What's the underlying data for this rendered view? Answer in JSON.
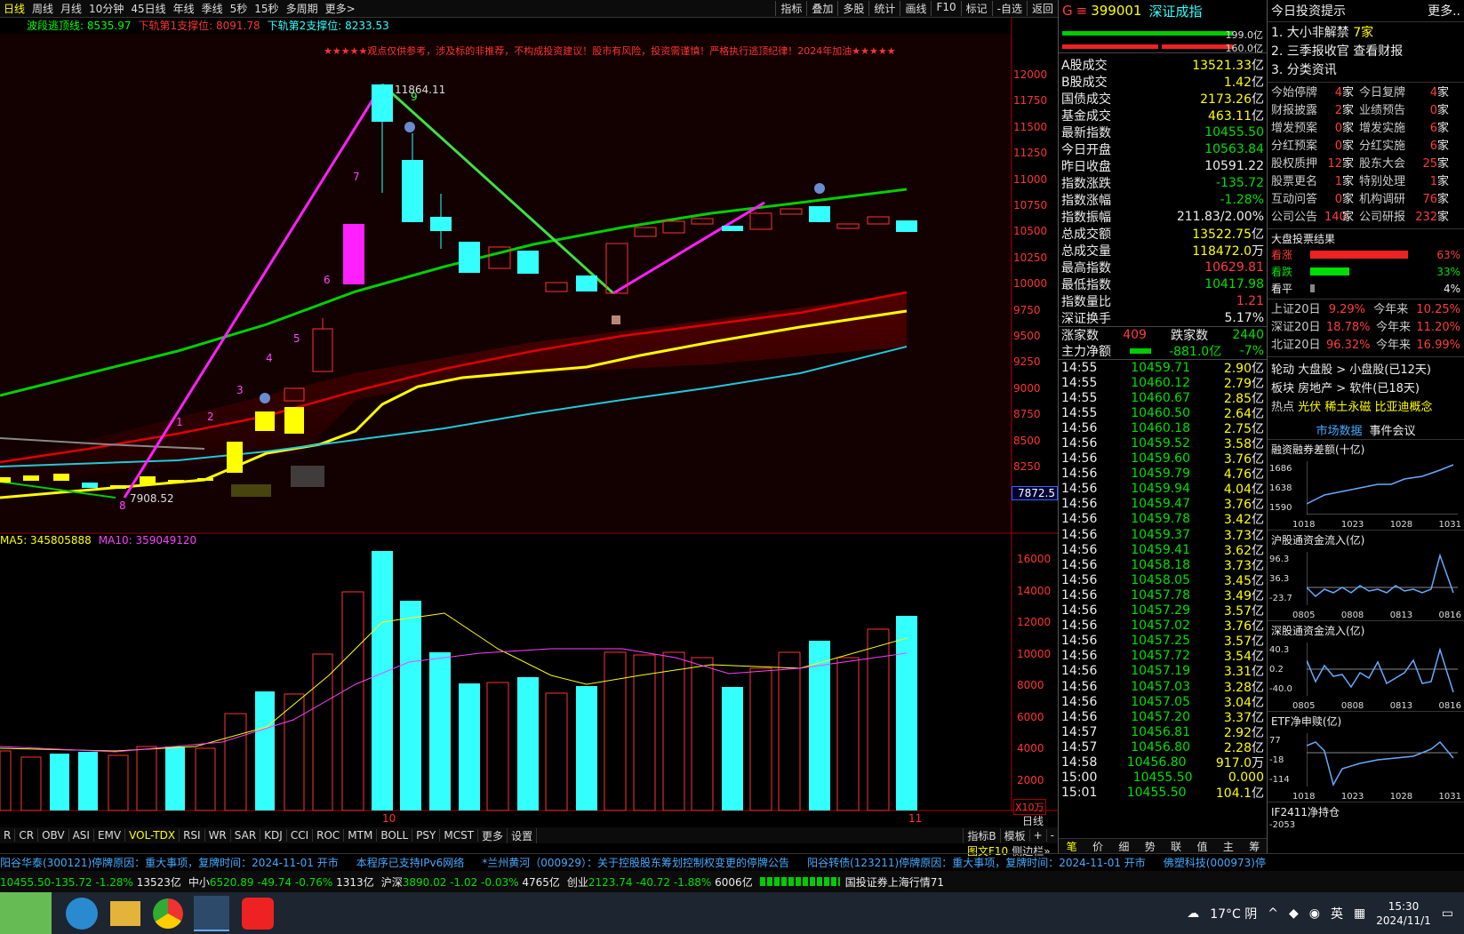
{
  "period_tabs": [
    "日线",
    "周线",
    "月线",
    "10分钟",
    "45日线",
    "年线",
    "季线",
    "5秒",
    "15秒",
    "多周期",
    "更多>"
  ],
  "tool_tabs": [
    "指标",
    "叠加",
    "多股",
    "统计",
    "画线",
    "F10",
    "标记",
    "-自选",
    "返回"
  ],
  "chart_header": {
    "indicator1": "波段逃顶线: 8535.97",
    "indicator2": "下轨第1支撑位: 8091.78",
    "indicator3": "下轨第2支撑位: 8233.53",
    "banner": "★★★★★观点仅供参考，涉及标的非推荐，不构成投资建议！股市有风险，投资需谨慎！严格执行逃顶纪律！2024年加油★★★★★"
  },
  "price_axis": [
    "12000",
    "11750",
    "11500",
    "11250",
    "11000",
    "10750",
    "10500",
    "10250",
    "10000",
    "9750",
    "9500",
    "9250",
    "9000",
    "8750",
    "8500",
    "8250"
  ],
  "price_high_label": "11864.11",
  "price_low_label": "7908.52",
  "cursor_price": "7872.5",
  "volume_header": {
    "ma5": "MA5: 345805888",
    "ma10": "MA10: 359049120"
  },
  "volume_axis": [
    "16000",
    "14000",
    "12000",
    "10000",
    "8000",
    "6000",
    "4000",
    "2000"
  ],
  "volume_unit": "X10万",
  "x_labels": [
    "10",
    "11"
  ],
  "period_label": "日线",
  "indicator_tabs": [
    "R",
    "CR",
    "OBV",
    "ASI",
    "EMV",
    "VOL-TDX",
    "RSI",
    "WR",
    "SAR",
    "KDJ",
    "CCI",
    "ROC",
    "MTM",
    "BOLL",
    "PSY",
    "MCST",
    "更多",
    "设置"
  ],
  "indicator_right": [
    "指标B",
    "模板",
    "+",
    "-"
  ],
  "candle_numbers": [
    "1",
    "2",
    "3",
    "4",
    "5",
    "6",
    "7",
    "8",
    "9"
  ],
  "quote": {
    "code": "399001",
    "name": "深证成指",
    "bar1": "199.0亿",
    "bar2": "160.0亿",
    "rows": [
      {
        "label": "A股成交",
        "value": "13521.33",
        "unit": "亿",
        "cls": "y"
      },
      {
        "label": "B股成交",
        "value": "1.42",
        "unit": "亿",
        "cls": "y"
      },
      {
        "label": "国债成交",
        "value": "2173.26",
        "unit": "亿",
        "cls": "y"
      },
      {
        "label": "基金成交",
        "value": "463.11",
        "unit": "亿",
        "cls": "y"
      },
      {
        "label": "最新指数",
        "value": "10455.50",
        "unit": "",
        "cls": "g"
      },
      {
        "label": "今日开盘",
        "value": "10563.84",
        "unit": "",
        "cls": "g"
      },
      {
        "label": "昨日收盘",
        "value": "10591.22",
        "unit": "",
        "cls": "w"
      },
      {
        "label": "指数涨跌",
        "value": "-135.72",
        "unit": "",
        "cls": "g"
      },
      {
        "label": "指数涨幅",
        "value": "-1.28%",
        "unit": "",
        "cls": "g"
      },
      {
        "label": "指数振幅",
        "value": "211.83/2.00%",
        "unit": "",
        "cls": "w"
      },
      {
        "label": "总成交额",
        "value": "13522.75",
        "unit": "亿",
        "cls": "y"
      },
      {
        "label": "总成交量",
        "value": "118472.0",
        "unit": "万",
        "cls": "y"
      },
      {
        "label": "最高指数",
        "value": "10629.81",
        "unit": "",
        "cls": "r"
      },
      {
        "label": "最低指数",
        "value": "10417.98",
        "unit": "",
        "cls": "g"
      },
      {
        "label": "指数量比",
        "value": "1.21",
        "unit": "",
        "cls": "r"
      },
      {
        "label": "深证换手",
        "value": "5.17%",
        "unit": "",
        "cls": "w"
      }
    ],
    "updown": {
      "up_label": "涨家数",
      "up": "409",
      "down_label": "跌家数",
      "down": "2440"
    },
    "mainflow": {
      "label": "主力净额",
      "value": "-881.0亿",
      "pct": "-7%"
    }
  },
  "ticks": [
    {
      "t": "14:55",
      "p": "10459.71",
      "v": "2.90",
      "u": "亿"
    },
    {
      "t": "14:55",
      "p": "10460.12",
      "v": "2.79",
      "u": "亿"
    },
    {
      "t": "14:55",
      "p": "10460.67",
      "v": "2.85",
      "u": "亿"
    },
    {
      "t": "14:55",
      "p": "10460.50",
      "v": "2.64",
      "u": "亿"
    },
    {
      "t": "14:56",
      "p": "10460.18",
      "v": "2.75",
      "u": "亿"
    },
    {
      "t": "14:56",
      "p": "10459.52",
      "v": "3.58",
      "u": "亿"
    },
    {
      "t": "14:56",
      "p": "10459.60",
      "v": "3.76",
      "u": "亿"
    },
    {
      "t": "14:56",
      "p": "10459.79",
      "v": "4.76",
      "u": "亿"
    },
    {
      "t": "14:56",
      "p": "10459.94",
      "v": "4.04",
      "u": "亿"
    },
    {
      "t": "14:56",
      "p": "10459.47",
      "v": "3.76",
      "u": "亿"
    },
    {
      "t": "14:56",
      "p": "10459.78",
      "v": "3.42",
      "u": "亿"
    },
    {
      "t": "14:56",
      "p": "10459.37",
      "v": "3.73",
      "u": "亿"
    },
    {
      "t": "14:56",
      "p": "10459.41",
      "v": "3.62",
      "u": "亿"
    },
    {
      "t": "14:56",
      "p": "10458.18",
      "v": "3.73",
      "u": "亿"
    },
    {
      "t": "14:56",
      "p": "10458.05",
      "v": "3.45",
      "u": "亿"
    },
    {
      "t": "14:56",
      "p": "10457.78",
      "v": "3.49",
      "u": "亿"
    },
    {
      "t": "14:56",
      "p": "10457.29",
      "v": "3.57",
      "u": "亿"
    },
    {
      "t": "14:56",
      "p": "10457.02",
      "v": "3.76",
      "u": "亿"
    },
    {
      "t": "14:56",
      "p": "10457.25",
      "v": "3.57",
      "u": "亿"
    },
    {
      "t": "14:56",
      "p": "10457.72",
      "v": "3.54",
      "u": "亿"
    },
    {
      "t": "14:56",
      "p": "10457.19",
      "v": "3.31",
      "u": "亿"
    },
    {
      "t": "14:56",
      "p": "10457.03",
      "v": "3.28",
      "u": "亿"
    },
    {
      "t": "14:56",
      "p": "10457.05",
      "v": "3.04",
      "u": "亿"
    },
    {
      "t": "14:56",
      "p": "10457.20",
      "v": "3.37",
      "u": "亿"
    },
    {
      "t": "14:57",
      "p": "10456.81",
      "v": "2.92",
      "u": "亿"
    },
    {
      "t": "14:57",
      "p": "10456.80",
      "v": "2.28",
      "u": "亿"
    },
    {
      "t": "14:58",
      "p": "10456.80",
      "v": "917.0",
      "u": "万"
    },
    {
      "t": "15:00",
      "p": "10455.50",
      "v": "0.000",
      "u": ""
    },
    {
      "t": "15:01",
      "p": "10455.50",
      "v": "104.1",
      "u": "亿"
    }
  ],
  "quote_tabs": [
    "笔",
    "价",
    "细",
    "势",
    "联",
    "值",
    "主",
    "筹"
  ],
  "quote_side_label": "图文F10",
  "quote_side_label2": "侧边栏»",
  "far": {
    "title": "今日投资提示",
    "more": "更多..",
    "tips": [
      {
        "a": "1. 大小非解禁",
        "b": "7家"
      },
      {
        "a": "2. 三季报收官",
        "b": "查看财报"
      },
      {
        "a": "3. 分类资讯",
        "b": ""
      }
    ],
    "stats": [
      [
        "今始停牌",
        "4",
        "家",
        "今日复牌",
        "4",
        "家"
      ],
      [
        "财报披露",
        "2",
        "家",
        "业绩预告",
        "0",
        "家"
      ],
      [
        "增发预案",
        "0",
        "家",
        "增发实施",
        "6",
        "家"
      ],
      [
        "分红预案",
        "0",
        "家",
        "分红实施",
        "6",
        "家"
      ],
      [
        "股权质押",
        "12",
        "家",
        "股东大会",
        "25",
        "家"
      ],
      [
        "股票更名",
        "1",
        "家",
        "特别处理",
        "1",
        "家"
      ],
      [
        "互动问答",
        "0",
        "家",
        "机构调研",
        "76",
        "家"
      ],
      [
        "公司公告",
        "140",
        "家",
        "公司研报",
        "232",
        "家"
      ]
    ],
    "vote_title": "大盘投票结果",
    "votes": [
      {
        "label": "看涨",
        "pct": "63%",
        "value": 63
      },
      {
        "label": "看跌",
        "pct": "33%",
        "value": 33
      },
      {
        "label": "看平",
        "pct": "4%",
        "value": 4
      }
    ],
    "perf": [
      {
        "a": "上证20日",
        "b": "9.29%",
        "c": "今年来",
        "d": "10.25%"
      },
      {
        "a": "深证20日",
        "b": "18.78%",
        "c": "今年来",
        "d": "11.20%"
      },
      {
        "a": "北证20日",
        "b": "96.32%",
        "c": "今年来",
        "d": "16.99%"
      }
    ],
    "rotate": [
      "轮动 大盘股 > 小盘股(已12天)",
      "板块 房地产 > 软件(已18天)"
    ],
    "hot_label": "热点",
    "hot": [
      "光伏",
      "稀土永磁",
      "比亚迪概念"
    ],
    "tab_market": "市场数据",
    "tab_event": "事件会议",
    "minicharts": [
      {
        "title": "融资融券差额(十亿)",
        "ylabels": [
          "1686",
          "1638",
          "1590"
        ],
        "xlabels": [
          "1018",
          "1023",
          "1028",
          "1031"
        ]
      },
      {
        "title": "沪股通资金流入(亿)",
        "ylabels": [
          "96.3",
          "36.3",
          "-23.7"
        ],
        "xlabels": [
          "0805",
          "0808",
          "0813",
          "0816"
        ]
      },
      {
        "title": "深股通资金流入(亿)",
        "ylabels": [
          "40.3",
          "0.2",
          "-40.0"
        ],
        "xlabels": [
          "0805",
          "0808",
          "0813",
          "0816"
        ]
      },
      {
        "title": "ETF净申赎(亿)",
        "ylabels": [
          "77",
          "-18",
          "-114"
        ],
        "xlabels": [
          "1018",
          "1023",
          "1028",
          "1031"
        ]
      },
      {
        "title": "IF2411净持仓",
        "ylabels": [
          "-2053"
        ],
        "xlabels": []
      }
    ]
  },
  "news": "阳谷华泰(300121)停牌原因：重大事项，复牌时间：2024-11-01 开市",
  "news_mid": "本程序已支持IPv6网络",
  "news2": "*兰州黄河（000929）：关于控股股东筹划控制权变更的停牌公告",
  "news3": "阳谷转债(123211)停牌原因：重大事项，复牌时间：2024-11-01 开市",
  "news4": "佛塑科技(000973)停",
  "index_bar": [
    {
      "name": "",
      "price": "10455.50",
      "chg": "-135.72",
      "pct": "-1.28%",
      "amt": "13523亿"
    },
    {
      "name": "中小",
      "price": "6520.89",
      "chg": "-49.74",
      "pct": "-0.76%",
      "amt": "1313亿"
    },
    {
      "name": "沪深",
      "price": "3890.02",
      "chg": "-1.02",
      "pct": "-0.03%",
      "amt": "4765亿"
    },
    {
      "name": "创业",
      "price": "2123.74",
      "chg": "-40.72",
      "pct": "-1.88%",
      "amt": "6006亿"
    }
  ],
  "status_text": "国投证券上海行情71",
  "taskbar": {
    "weather": "17°C 阴",
    "ime": "英",
    "time": "15:30",
    "date": "2024/11/1"
  }
}
